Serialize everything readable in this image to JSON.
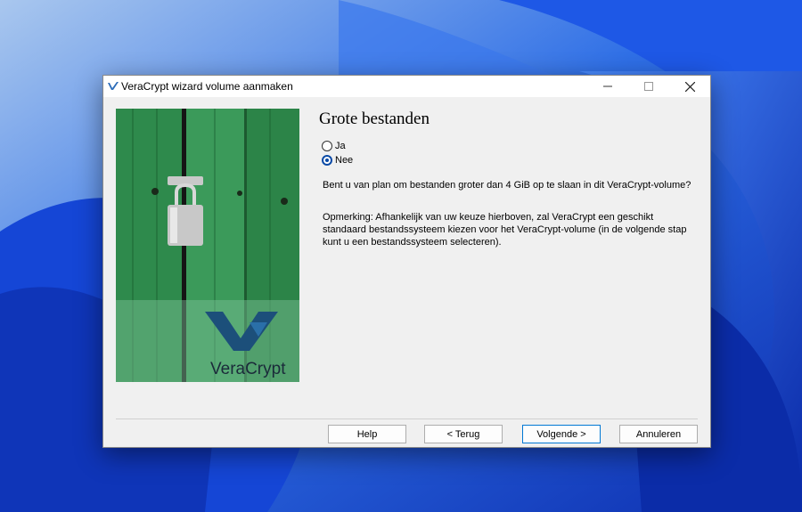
{
  "window": {
    "title": "VeraCrypt wizard volume aanmaken"
  },
  "page": {
    "heading": "Grote bestanden",
    "options": [
      {
        "label": "Ja",
        "selected": false
      },
      {
        "label": "Nee",
        "selected": true
      }
    ],
    "question": "Bent u van plan om bestanden groter dan 4 GiB op te slaan in dit VeraCrypt-volume?",
    "note": "Opmerking: Afhankelijk van uw keuze hierboven, zal VeraCrypt een geschikt standaard bestandssysteem kiezen voor het VeraCrypt-volume (in de volgende stap kunt u een bestandssysteem selecteren)."
  },
  "image": {
    "logo_text": "VeraCrypt"
  },
  "buttons": {
    "help": "Help",
    "back": "< Terug",
    "next": "Volgende >",
    "cancel": "Annuleren"
  },
  "colors": {
    "accent": "#0a4aa6",
    "wallpaper": "#1a4fd8"
  }
}
